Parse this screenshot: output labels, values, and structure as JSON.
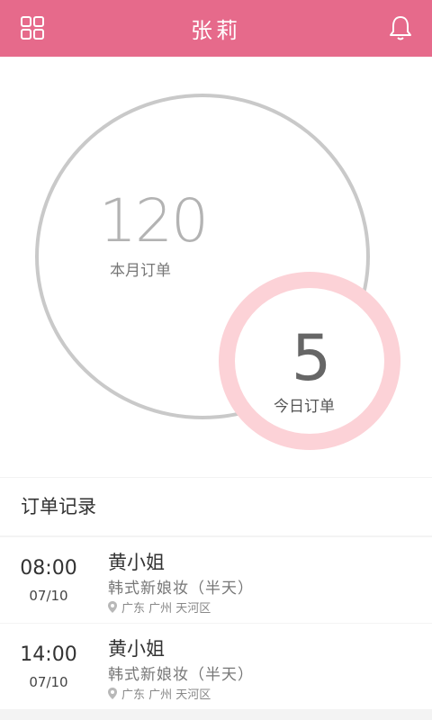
{
  "header": {
    "title": "张莉",
    "left_icon": "grid-icon",
    "right_icon": "bell-icon",
    "bg_color": "#e66a8b"
  },
  "stats": {
    "month_count": "120",
    "month_label": "本月订单",
    "today_count": "5",
    "today_label": "今日订单"
  },
  "records": {
    "title": "订单记录",
    "items": [
      {
        "time": "08:00",
        "date": "07/10",
        "name": "黄小姐",
        "service": "韩式新娘妆（半天）",
        "location": "广东 广州 天河区"
      },
      {
        "time": "14:00",
        "date": "07/10",
        "name": "黄小姐",
        "service": "韩式新娘妆（半天）",
        "location": "广东 广州 天河区"
      }
    ]
  }
}
